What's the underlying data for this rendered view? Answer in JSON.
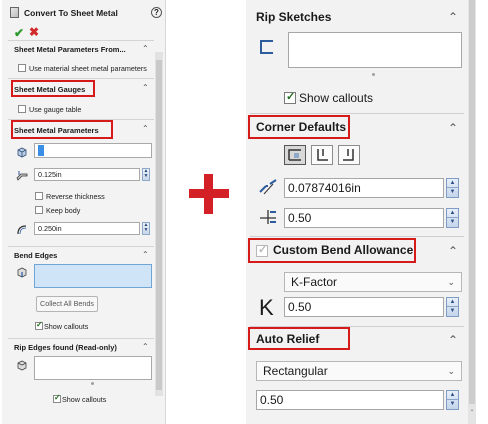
{
  "left_panel": {
    "title": "Convert To Sheet Metal",
    "help_glyph": "?",
    "ok_glyph": "✔",
    "cancel_glyph": "✖",
    "params_from_header": "Sheet Metal Parameters From...",
    "use_material_params_label": "Use material sheet metal parameters",
    "gauges_header": "Sheet Metal Gauges",
    "use_gauge_table_label": "Use gauge table",
    "params_header": "Sheet Metal Parameters",
    "thickness_value": "0.125in",
    "reverse_thickness_label": "Reverse thickness",
    "keep_body_label": "Keep body",
    "bend_radius_value": "0.250in",
    "bend_edges_header": "Bend Edges",
    "collect_all_bends_label": "Collect All Bends",
    "show_callouts_label": "Show callouts",
    "rip_edges_header": "Rip Edges found (Read-only)",
    "show_callouts_label_2": "Show callouts",
    "chevron_up": "⌃"
  },
  "right_panel": {
    "rip_sketches_header": "Rip Sketches",
    "show_callouts_label": "Show callouts",
    "corner_defaults_header": "Corner Defaults",
    "gap_value": "0.07874016in",
    "ratio_value": "0.50",
    "custom_bend_allowance_header": "Custom Bend Allowance",
    "bend_type_value": "K-Factor",
    "k_glyph": "K",
    "k_value": "0.50",
    "auto_relief_header": "Auto Relief",
    "relief_type_value": "Rectangular",
    "relief_ratio_value": "0.50",
    "chevron_up": "⌃",
    "dropdown_arrow": "⌄",
    "spin_up": "▲",
    "spin_down": "▼"
  },
  "colors": {
    "highlight_red": "#d61a1a",
    "plus_red": "#d32027",
    "ok_green": "#2e9a2e",
    "selection_blue": "#cfe4f7",
    "spin_blue": "#7f9dc4"
  },
  "icons": [
    "convert-sheet-metal-icon",
    "help-icon",
    "ok-check-icon",
    "cancel-x-icon",
    "face-selection-icon",
    "thickness-icon",
    "bend-radius-icon",
    "bend-edges-icon",
    "rip-edges-icon",
    "rip-sketch-icon",
    "corner-overlap-icon",
    "corner-underlap-icon",
    "corner-open-butt-icon",
    "gap-distance-icon",
    "overlap-ratio-icon",
    "k-factor-icon",
    "plus-sign"
  ]
}
